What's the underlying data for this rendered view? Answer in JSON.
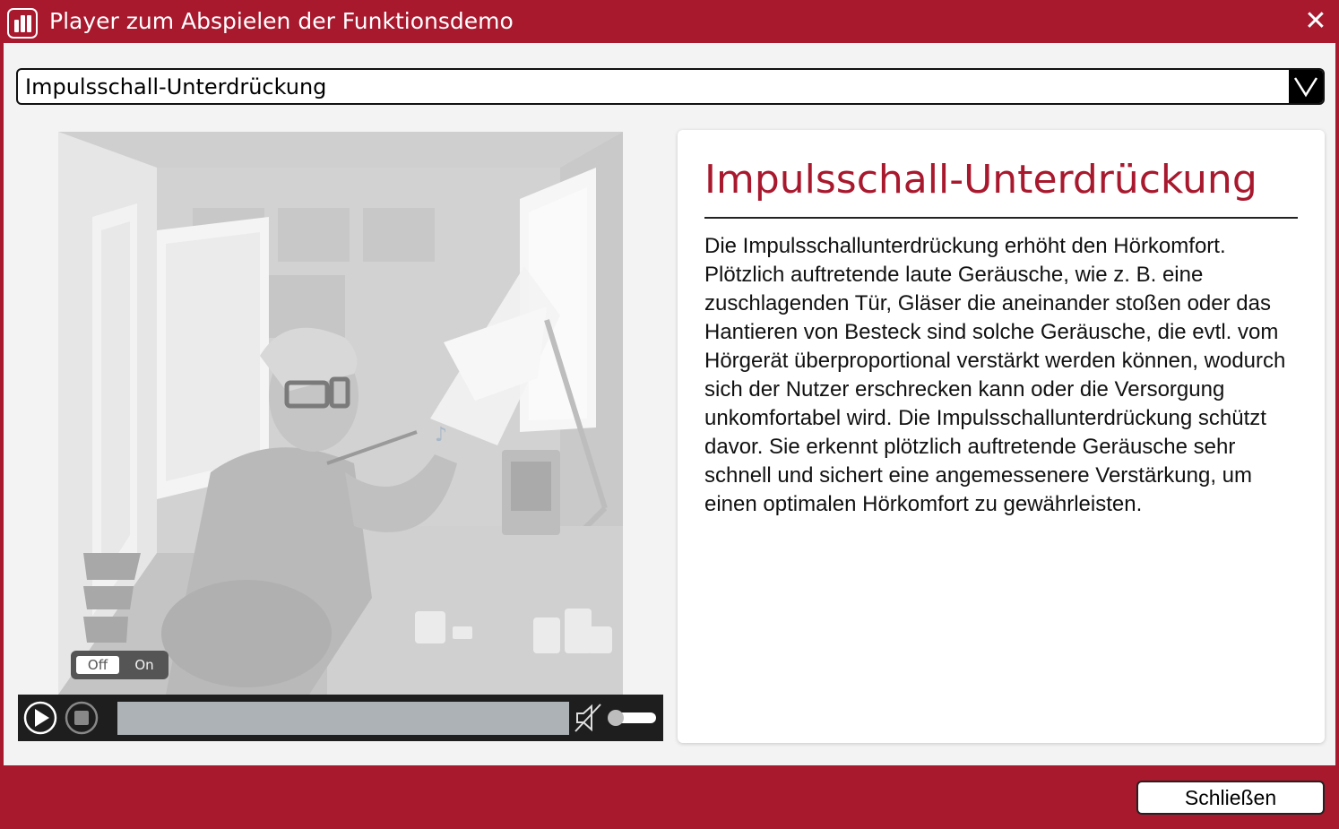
{
  "window": {
    "title": "Player zum Abspielen der Funktionsdemo"
  },
  "selector": {
    "selected_value": "Impulsschall-Unterdrückung"
  },
  "demo": {
    "toggle_off_label": "Off",
    "toggle_on_label": "On",
    "toggle_state": "Off"
  },
  "player": {
    "progress": 0,
    "volume": 0,
    "muted": true
  },
  "info": {
    "heading": "Impulsschall-Unterdrückung",
    "body": "Die Impulsschallunterdrückung erhöht den Hörkomfort. Plötzlich auftretende laute Geräusche, wie z. B. eine zuschlagenden Tür, Gläser die aneinander stoßen oder das Hantieren von Besteck sind solche Geräusche, die evtl. vom Hörgerät überproportional verstärkt werden können, wodurch sich der Nutzer erschrecken kann oder die Versorgung unkomfortabel wird. Die Impulsschallunterdrückung schützt davor. Sie erkennt plötzlich auftretende Geräusche sehr schnell und sichert eine angemessenere Verstärkung, um einen optimalen Hörkomfort zu gewährleisten."
  },
  "footer": {
    "close_label": "Schließen"
  },
  "colors": {
    "brand": "#a8192e",
    "content_bg": "#f3f3f3",
    "player_bg": "#1e1e1e",
    "progress_track": "#adb2b7"
  },
  "icons": {
    "app": "bar-chart-icon",
    "close": "close-icon",
    "dropdown": "chevron-down-icon",
    "play": "play-icon",
    "stop": "stop-icon",
    "mute": "speaker-muted-icon"
  }
}
